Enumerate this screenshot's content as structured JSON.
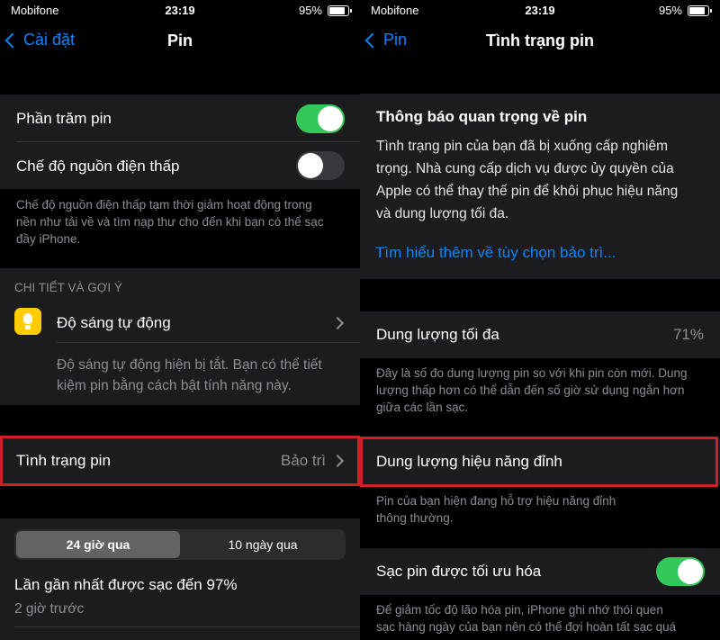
{
  "status_bar": {
    "carrier": "Mobifone",
    "time": "23:19",
    "battery": "95%",
    "battery_level": 0.95
  },
  "left": {
    "nav": {
      "back": "Cài đặt",
      "title": "Pin"
    },
    "battery_percent": {
      "label": "Phần trăm pin",
      "on": true
    },
    "low_power": {
      "label": "Chế độ nguồn điện thấp",
      "on": false
    },
    "low_power_footer": [
      "Chế độ nguồn điện thấp tạm thời giảm hoạt động trong",
      "nền như tải về và tìm nạp thư cho đến khi bạn có thể sạc",
      "đầy iPhone."
    ],
    "section_header": "CHI TIẾT VÀ GỢI Ý",
    "auto_brightness": {
      "label": "Độ sáng tự động",
      "description": [
        "Độ sáng tự động hiện bị tắt. Bạn có thể tiết",
        "kiệm pin bằng cách bật tính năng này."
      ]
    },
    "battery_health": {
      "label": "Tình trạng pin",
      "value": "Bảo trì"
    },
    "segments": [
      "24 giờ qua",
      "10 ngày qua"
    ],
    "last_charged": {
      "title": "Lần gần nhất được sạc đến 97%",
      "subtitle": "2 giờ trước"
    }
  },
  "right": {
    "nav": {
      "back": "Pin",
      "title": "Tình trạng pin"
    },
    "notice": {
      "title": "Thông báo quan trọng về pin",
      "body": [
        "Tình trạng pin của bạn đã bị xuống cấp nghiêm",
        "trọng. Nhà cung cấp dịch vụ được ủy quyền của",
        "Apple có thể thay thế pin để khôi phục hiệu năng",
        "và dung lượng tối đa."
      ],
      "link": "Tìm hiểu thêm về tùy chọn bảo trì..."
    },
    "max_capacity": {
      "label": "Dung lượng tối đa",
      "value": "71%",
      "footer": [
        "Đây là số đo dung lượng pin so với khi pin còn mới. Dung",
        "lượng thấp hơn có thể dẫn đến số giờ sử dụng ngắn hơn",
        "giữa các lần sạc."
      ]
    },
    "peak_performance": {
      "label": "Dung lượng hiệu năng đỉnh",
      "footer": [
        "Pin của bạn hiện đang hỗ trợ hiệu năng đỉnh",
        "thông thường."
      ]
    },
    "optimized_charging": {
      "label": "Sạc pin được tối ưu hóa",
      "on": true,
      "footer": [
        "Để giảm tốc độ lão hóa pin, iPhone ghi nhớ thói quen",
        "sạc hàng ngày của bạn nên có thể đợi hoàn tất sạc quá"
      ]
    }
  }
}
